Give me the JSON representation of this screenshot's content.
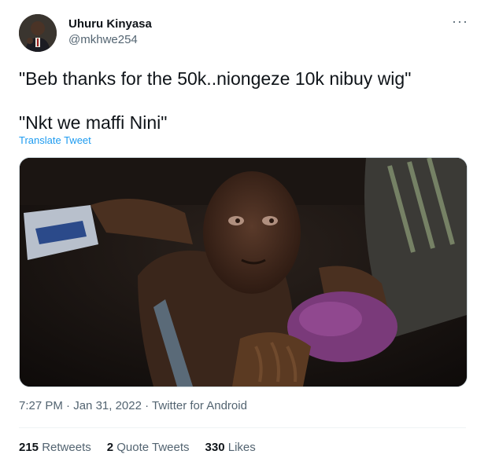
{
  "author": {
    "name": "Uhuru Kinyasa",
    "handle": "@mkhwe254"
  },
  "tweet": {
    "lines": [
      "\"Beb thanks for the 50k..niongeze 10k nibuy wig\"",
      "\"Nkt we maffi Nini\""
    ],
    "translate_label": "Translate Tweet"
  },
  "more_icon": "ellipsis-icon",
  "meta": {
    "time": "7:27 PM",
    "separator": " · ",
    "date": "Jan 31, 2022",
    "source": "Twitter for Android"
  },
  "stats": {
    "retweets_count": "215",
    "retweets_label": "Retweets",
    "quote_count": "2",
    "quote_label": "Quote Tweets",
    "likes_count": "330",
    "likes_label": "Likes"
  },
  "colors": {
    "link": "#1d9bf0",
    "secondary_text": "#536471",
    "primary_text": "#0f1419"
  }
}
